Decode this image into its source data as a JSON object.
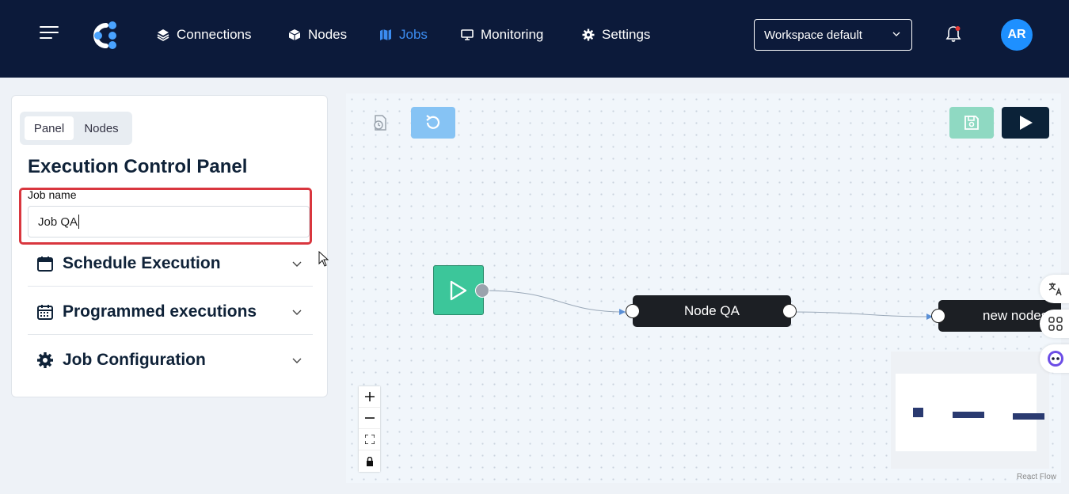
{
  "nav": {
    "items": [
      {
        "label": "Connections",
        "icon": "layers-icon"
      },
      {
        "label": "Nodes",
        "icon": "cube-icon"
      },
      {
        "label": "Jobs",
        "icon": "map-icon",
        "active": true
      },
      {
        "label": "Monitoring",
        "icon": "monitor-icon"
      },
      {
        "label": "Settings",
        "icon": "gear-icon"
      }
    ],
    "workspace": "Workspace default",
    "avatar_initials": "AR"
  },
  "panel": {
    "tabs": [
      "Panel",
      "Nodes"
    ],
    "active_tab": "Panel",
    "title": "Execution Control Panel",
    "job_name_label": "Job name",
    "job_name_value": "Job QA",
    "sections": [
      {
        "label": "Schedule Execution",
        "icon": "calendar-icon"
      },
      {
        "label": "Programmed executions",
        "icon": "calendar-grid-icon"
      },
      {
        "label": "Job Configuration",
        "icon": "gear-icon"
      }
    ]
  },
  "canvas": {
    "nodes": [
      {
        "label": "Node QA"
      },
      {
        "label": "new nodes"
      }
    ],
    "attribution": "React Flow"
  },
  "colors": {
    "topbar": "#0c1a3a",
    "accent": "#3b8cf0",
    "start_node": "#3cc69a",
    "highlight": "#d9363e"
  }
}
